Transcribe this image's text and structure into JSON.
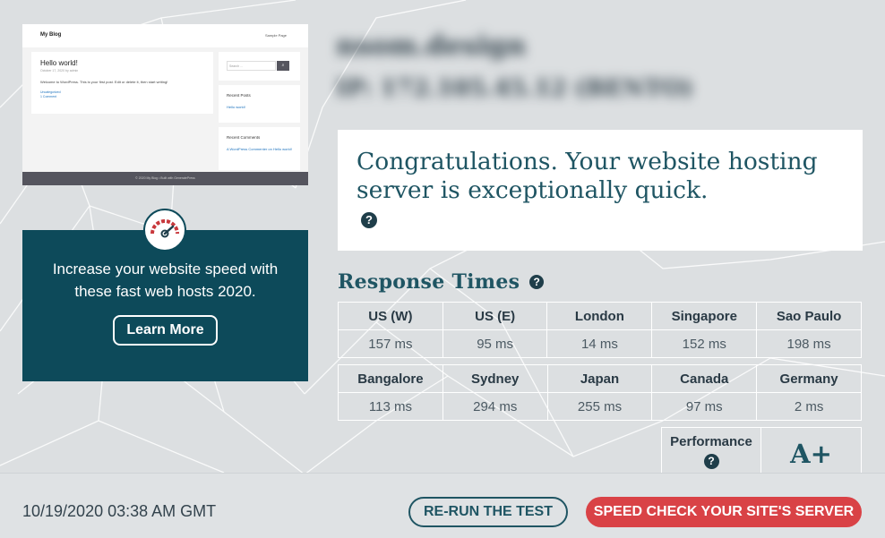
{
  "preview": {
    "site_title": "My Blog",
    "menu_item": "Sample Page",
    "post_title": "Hello world!",
    "post_meta": "October 17, 2020 by admin",
    "post_text": "Welcome to WordPress. This is your first post. Edit or delete it, then start writing!",
    "post_category": "Uncategorized",
    "post_comments": "1 Comment",
    "search_placeholder": "Search ...",
    "recent_posts_title": "Recent Posts",
    "recent_post_link": "Hello world!",
    "recent_comments_title": "Recent Comments",
    "recent_comment": "A WordPress Commenter on Hello world!",
    "footer": "© 2020 My Blog • Built with GeneratePress"
  },
  "promo": {
    "text": "Increase your website speed with these fast web hosts 2020.",
    "button": "Learn More"
  },
  "site": {
    "title": "nsom.design",
    "ip": "IP: 172.105.45.12 (BENTO)"
  },
  "result": {
    "message": "Congratulations. Your website hosting server is exceptionally quick.",
    "help": "?"
  },
  "response_times": {
    "heading": "Response Times",
    "help": "?",
    "row1": [
      {
        "location": "US (W)",
        "time": "157 ms"
      },
      {
        "location": "US (E)",
        "time": "95 ms"
      },
      {
        "location": "London",
        "time": "14 ms"
      },
      {
        "location": "Singapore",
        "time": "152 ms"
      },
      {
        "location": "Sao Paulo",
        "time": "198 ms"
      }
    ],
    "row2": [
      {
        "location": "Bangalore",
        "time": "113 ms"
      },
      {
        "location": "Sydney",
        "time": "294 ms"
      },
      {
        "location": "Japan",
        "time": "255 ms"
      },
      {
        "location": "Canada",
        "time": "97 ms"
      },
      {
        "location": "Germany",
        "time": "2 ms"
      }
    ]
  },
  "performance": {
    "label": "Performance",
    "help": "?",
    "grade": "A+"
  },
  "footer": {
    "timestamp": "10/19/2020 03:38 AM GMT",
    "rerun_button": "RE-RUN THE TEST",
    "speed_check_button": "SPEED CHECK YOUR SITE'S SERVER"
  },
  "colors": {
    "background": "#dcdfe1",
    "promo": "#0d4a5a",
    "heading": "#1f5563",
    "accent_red": "#d94246"
  }
}
